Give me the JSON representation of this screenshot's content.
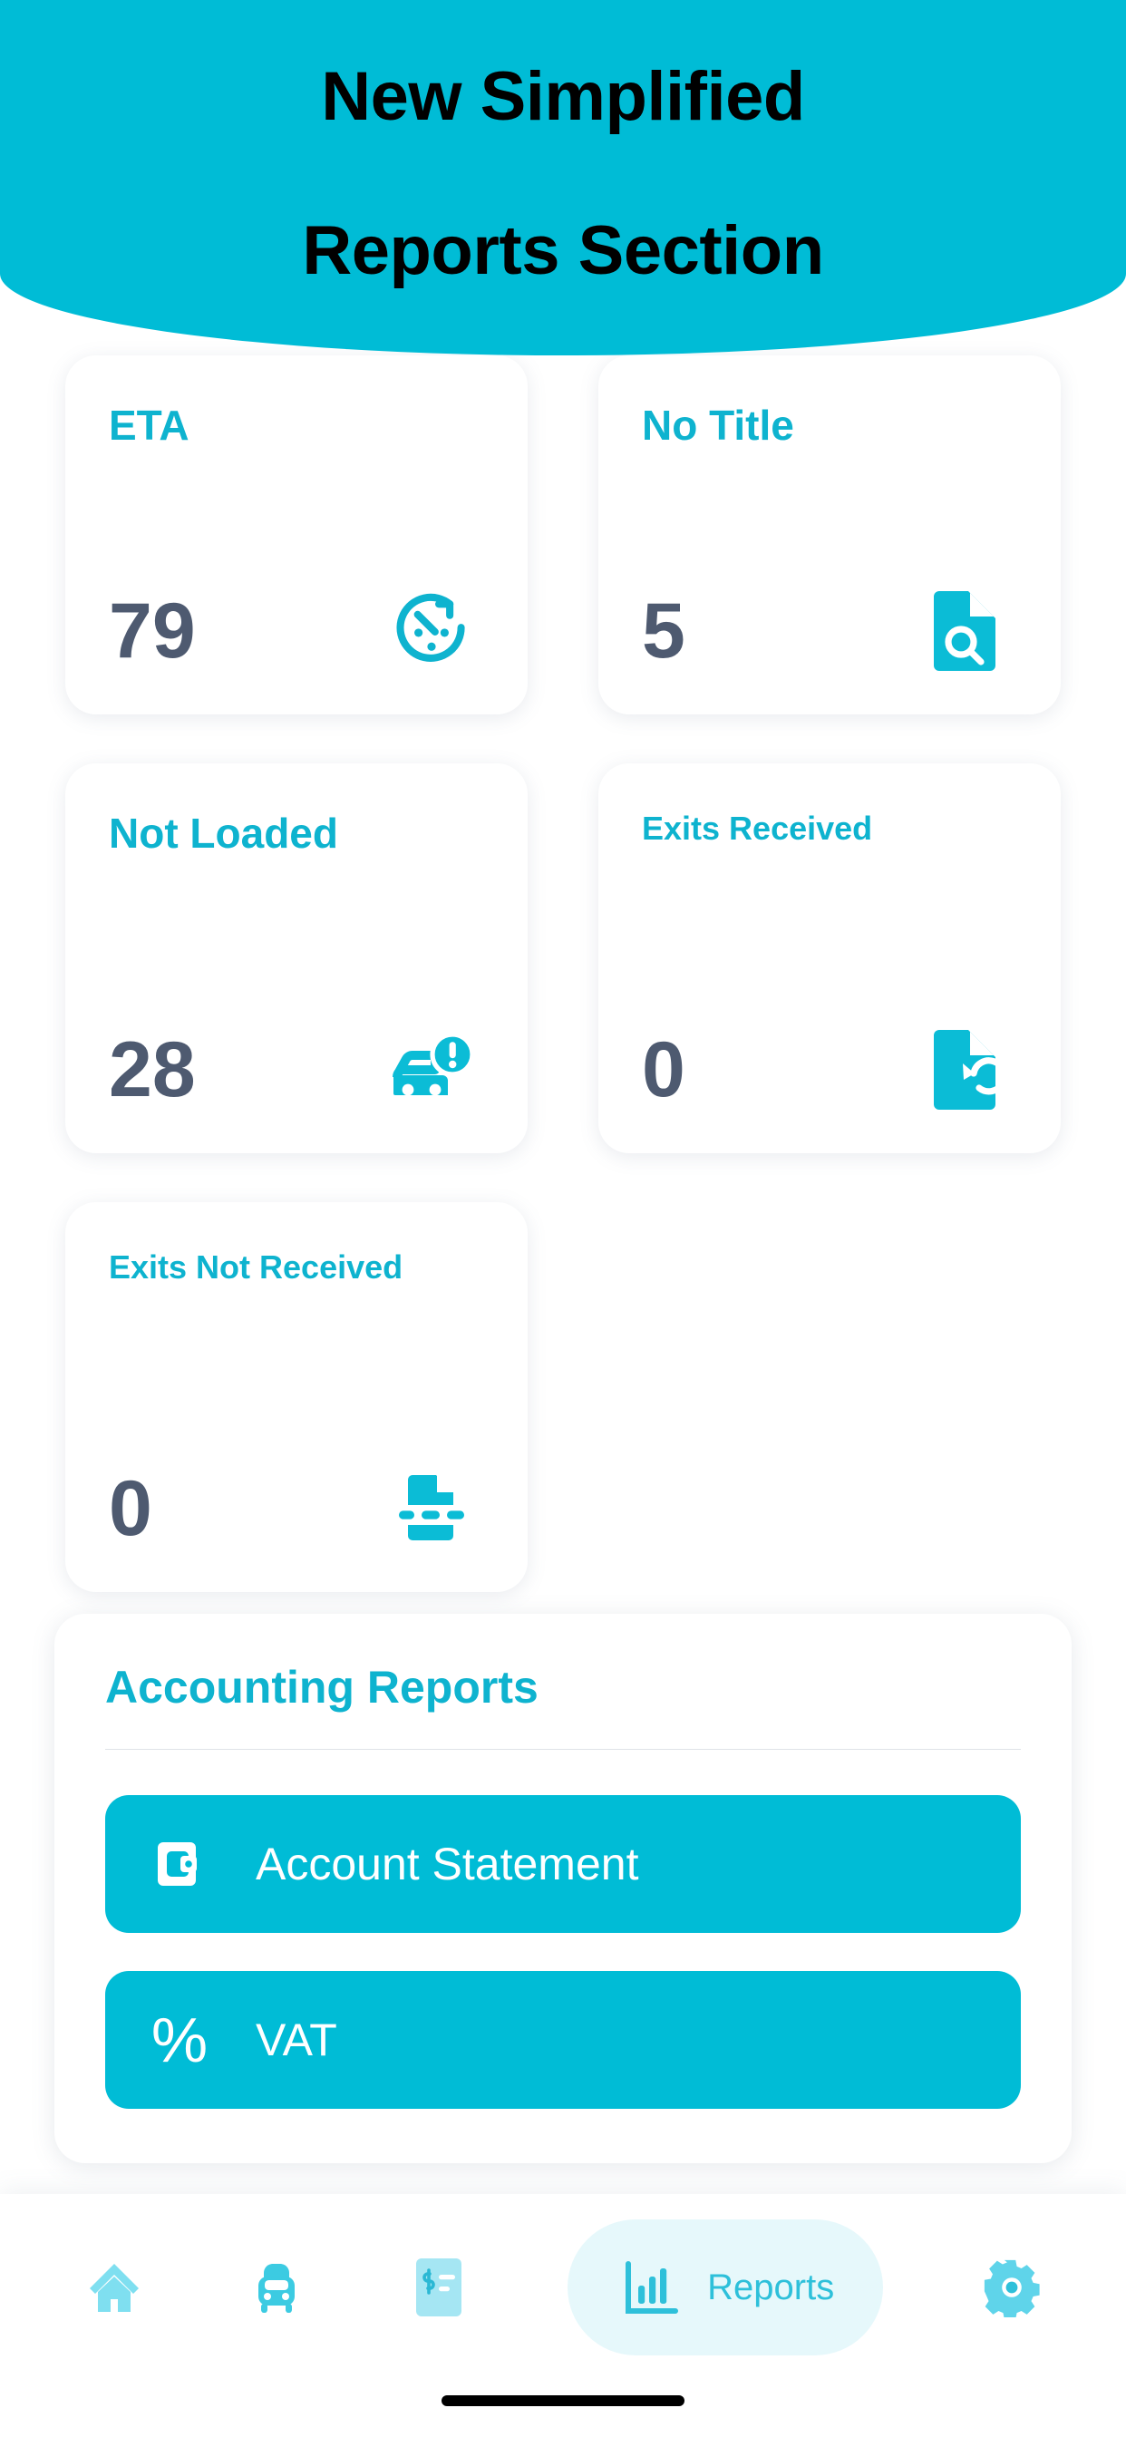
{
  "header": {
    "title_line_1": "New Simplified",
    "title_line_2": "Reports Section",
    "background_color": "#00bcd6",
    "text_color": "#000000"
  },
  "colors": {
    "accent": "#00bcd6",
    "title_teal": "#0eb3cf",
    "value_slate": "#4e5a70",
    "nav_active_bg": "#e6f8fb",
    "nav_active_text": "#2ec0da"
  },
  "stat_cards": [
    {
      "title": "ETA",
      "value": "79",
      "icon": "speedometer-icon"
    },
    {
      "title": "No Title",
      "value": "5",
      "icon": "document-search-icon"
    },
    {
      "title": "Not Loaded",
      "value": "28",
      "icon": "car-alert-icon"
    },
    {
      "title": "Exits Received",
      "value": "0",
      "icon": "document-restore-icon"
    },
    {
      "title": "Exits Not Received",
      "value": "0",
      "icon": "document-dashed-icon"
    }
  ],
  "reports_panel": {
    "title": "Accounting Reports",
    "buttons": [
      {
        "label": "Account Statement",
        "icon": "wallet-icon"
      },
      {
        "label": "VAT",
        "icon": "percent-icon"
      }
    ]
  },
  "bottom_nav": {
    "items": [
      {
        "label": "",
        "icon": "home-icon",
        "active": false
      },
      {
        "label": "",
        "icon": "car-icon",
        "active": false
      },
      {
        "label": "",
        "icon": "invoice-icon",
        "active": false
      },
      {
        "label": "Reports",
        "icon": "bar-chart-icon",
        "active": true
      },
      {
        "label": "",
        "icon": "gear-icon",
        "active": false
      }
    ]
  }
}
